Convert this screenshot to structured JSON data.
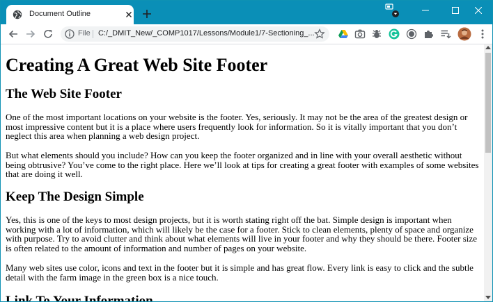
{
  "tab": {
    "title": "Document Outline"
  },
  "address": {
    "scheme_label": "File",
    "url": "C:/_DMIT_New/_COMP1017/Lessons/Module1/7-Sectioning_..."
  },
  "icons": {
    "favicon": "globe-icon",
    "tab_close": "close-icon",
    "new_tab": "plus-icon",
    "back": "arrow-left-icon",
    "forward": "arrow-right-icon",
    "reload": "reload-icon",
    "info": "info-icon",
    "bookmark": "star-icon",
    "extensions": [
      "google-drive-icon",
      "camera-icon",
      "bug-icon",
      "grammarly-icon",
      "circle-icon",
      "puzzle-icon",
      "reading-list-icon",
      "avatar",
      "more-vert-icon"
    ],
    "window_controls": [
      "tab-search-icon",
      "minimize-icon",
      "maximize-icon",
      "close-icon"
    ]
  },
  "colors": {
    "titlebar": "#0a8fb7",
    "tab_bg": "#ffffff",
    "omnibox_bg": "#f1f3f4"
  },
  "page": {
    "h1": "Creating A Great Web Site Footer",
    "section1_heading": "The Web Site Footer",
    "section1_p1": "One of the most important locations on your website is the footer. Yes, seriously. It may not be the area of the greatest design or most impressive content but it is a place where users frequently look for information. So it is vitally important that you don’t neglect this area when planning a web design project.",
    "section1_p2": "But what elements should you include? How can you keep the footer organized and in line with your overall aesthetic without being obtrusive? You’ve come to the right place. Here we’ll look at tips for creating a great footer with examples of some websites that are doing it well.",
    "section2_heading": "Keep The Design Simple",
    "section2_p1": "Yes, this is one of the keys to most design projects, but it is worth stating right off the bat. Simple design is important when working with a lot of information, which will likely be the case for a footer. Stick to clean elements, plenty of space and organize with purpose. Try to avoid clutter and think about what elements will live in your footer and why they should be there. Footer size is often related to the amount of information and number of pages on your website.",
    "section2_p2": "Many web sites use color, icons and text in the footer but it is simple and has great flow. Every link is easy to click and the subtle detail with the farm image in the green box is a nice touch.",
    "section3_heading": "Link To Your Information"
  }
}
